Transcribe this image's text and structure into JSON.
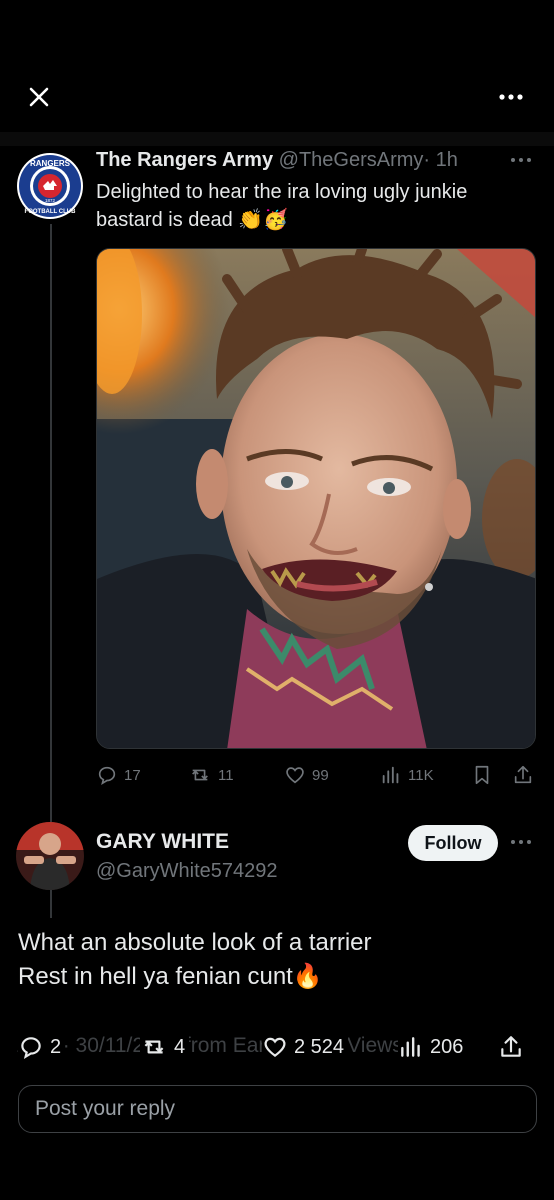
{
  "topbar": {
    "close_icon": "close-icon",
    "more_icon": "more-horizontal-icon"
  },
  "quoted_post": {
    "name": "The Rangers Army",
    "handle": "@TheGersArmy",
    "time": "· 1h",
    "text": "Delighted to hear the ira loving ugly junkie bastard is dead",
    "emojis": "👏🥳",
    "avatar_text": {
      "top": "RANGERS",
      "bottom": "FOOTBALL CLUB",
      "year": "1872"
    },
    "stats": {
      "replies": "17",
      "reposts": "11",
      "likes": "99",
      "views": "11K"
    }
  },
  "reply_post": {
    "name": "GARY WHITE",
    "handle": "@GaryWhite574292",
    "follow_label": "Follow",
    "text_line1": "What an absolute look of a tarrier",
    "text_line2": "Rest in hell ya fenian cunt",
    "emoji": "🔥",
    "meta_faded": "18:2 · 30/11/2023 from Earth 2 524 Views",
    "stats": {
      "replies": "2",
      "reposts": "4",
      "likes": "2 524",
      "views": "206"
    }
  },
  "composer": {
    "placeholder": "Post your reply"
  },
  "colors": {
    "background": "#000000",
    "text": "#e7e9ea",
    "muted": "#71767b",
    "rangers_blue": "#1b3d8f",
    "rangers_red": "#d6262f"
  }
}
